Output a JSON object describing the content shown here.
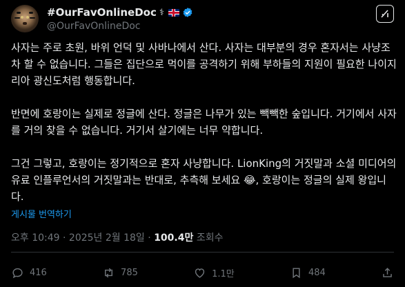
{
  "author": {
    "display_name": "#OurFavOnlineDoc",
    "handle": "@OurFavOnlineDoc",
    "name_emoji": "⚕",
    "flag_icon": "uk-flag-icon",
    "verified_icon": "verified-badge-icon"
  },
  "tweet": {
    "paragraphs": [
      "사자는 주로 초원, 바위 언덕 및 사바나에서 산다. 사자는 대부분의 경우 혼자서는 사냥조차 할 수 없습니다. 그들은 집단으로 먹이를 공격하기 위해 부하들의 지원이 필요한 나이지리아 광신도처럼 행동합니다.",
      "반면에 호랑이는 실제로 정글에 산다. 정글은 나무가 있는 빽빽한 숲입니다. 거기에서 사자를 거의 찾을 수 없습니다. 거기서 살기에는 너무 약합니다.",
      "그건 그렇고, 호랑이는 정기적으로 혼자 사냥합니다. LionKing의 거짓말과 소셜 미디어의 유료 인플루언서의 거짓말과는 반대로, 추측해 보세요 😂, 호랑이는 정글의 실제 왕입니다."
    ],
    "translate_label": "게시물 번역하기"
  },
  "meta": {
    "time": "오후 10:49",
    "date": "2025년 2월 18일",
    "separator": "·",
    "views_count": "100.4만",
    "views_label": "조회수"
  },
  "actions": {
    "replies": "416",
    "reposts": "785",
    "likes": "1.1만",
    "bookmarks": "484"
  },
  "colors": {
    "background": "#000000",
    "text": "#e7e9ea",
    "secondary": "#71767b",
    "accent": "#1d9bf0"
  }
}
